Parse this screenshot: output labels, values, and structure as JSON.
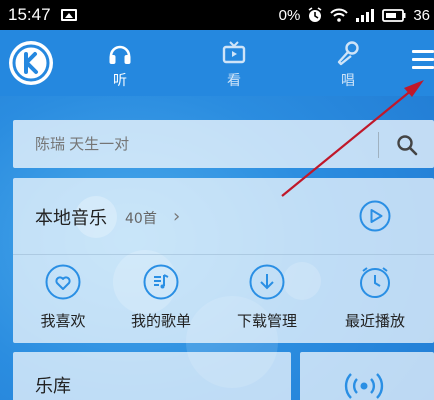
{
  "status_bar": {
    "time": "15:47",
    "battery_percent": "0%",
    "battery_text": "36"
  },
  "header": {
    "logo_letter": "K",
    "tabs": [
      {
        "label": "听",
        "icon": "headphones-icon",
        "active": true
      },
      {
        "label": "看",
        "icon": "tv-icon",
        "active": false
      },
      {
        "label": "唱",
        "icon": "microphone-icon",
        "active": false
      }
    ]
  },
  "search": {
    "placeholder": "陈瑞 天生一对"
  },
  "local_music": {
    "title": "本地音乐",
    "count": "40首",
    "quick_actions": [
      {
        "label": "我喜欢",
        "icon": "heart-icon"
      },
      {
        "label": "我的歌单",
        "icon": "playlist-icon"
      },
      {
        "label": "下载管理",
        "icon": "download-icon"
      },
      {
        "label": "最近播放",
        "icon": "clock-icon"
      }
    ]
  },
  "library": {
    "title": "乐库"
  },
  "colors": {
    "accent": "#2588df",
    "icon_blue": "#2a8fe4",
    "annotation": "#c0182a"
  }
}
